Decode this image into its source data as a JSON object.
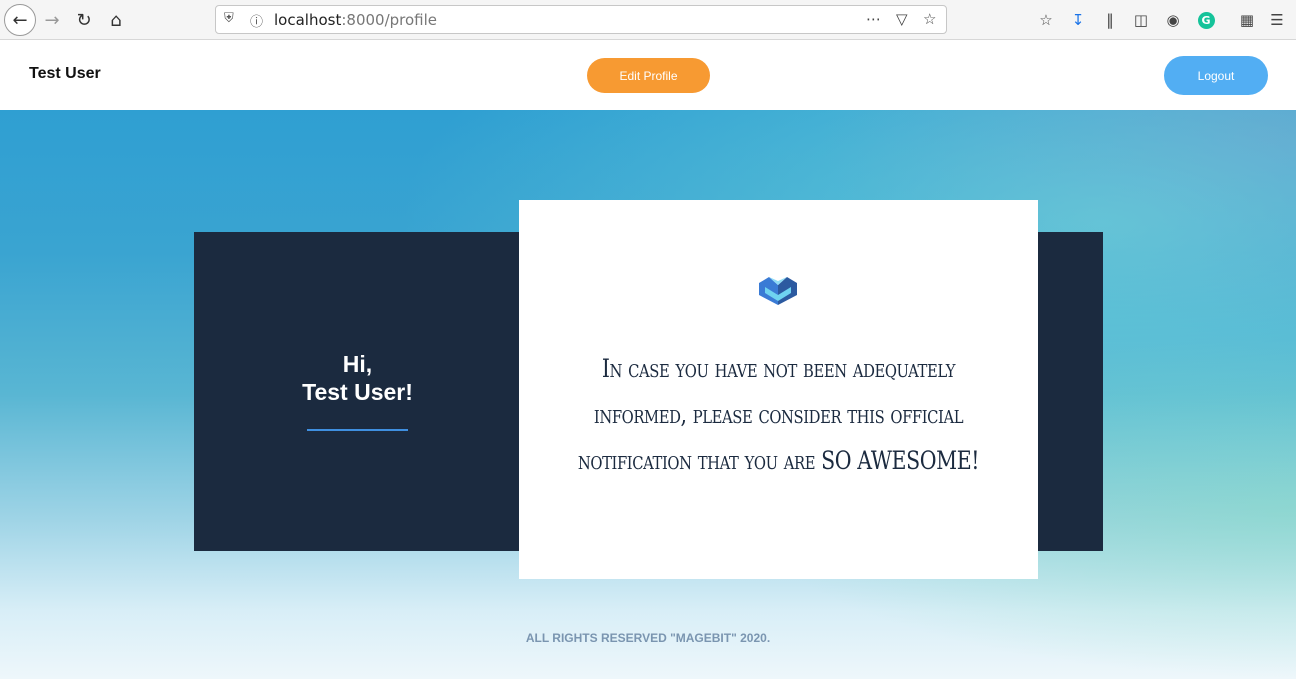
{
  "browser": {
    "url_host": "localhost",
    "url_rest": ":8000/profile",
    "icons": [
      "back-icon",
      "forward-icon",
      "reload-icon",
      "home-icon",
      "shield-icon",
      "info-icon",
      "more-icon",
      "pocket-icon",
      "star-icon",
      "bookmark-icon",
      "download-icon",
      "library-icon",
      "sidebar-icon",
      "account-icon",
      "grammarly-icon",
      "extensions-icon",
      "menu-icon"
    ]
  },
  "header": {
    "user_name": "Test User",
    "edit_label": "Edit Profile",
    "logout_label": "Logout"
  },
  "profile": {
    "greeting_line1": "Hi,",
    "greeting_line2": "Test User!",
    "message": "In case you have not been adequately informed, please consider this official notification that you are SO AWESOME!"
  },
  "footer": {
    "copyright": "ALL RIGHTS RESERVED \"MAGEBIT\" 2020."
  },
  "colors": {
    "edit_button": "#f79a32",
    "logout_button": "#52aef3",
    "dark_card": "#1b2a3f",
    "accent_line": "#3f8fe0"
  }
}
